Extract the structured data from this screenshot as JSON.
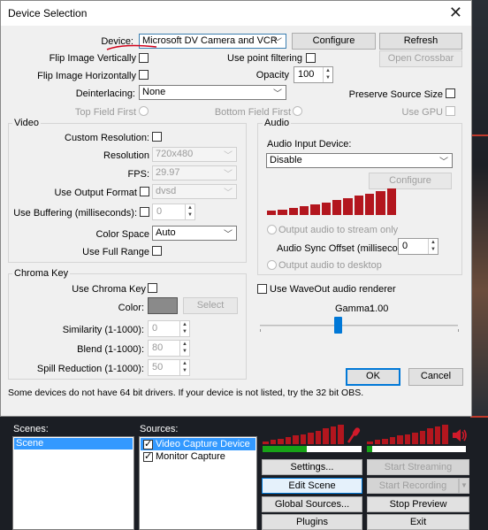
{
  "dialog": {
    "title": "Device Selection",
    "close_glyph": "✕",
    "device": {
      "label": "Device:",
      "value": "Microsoft DV Camera and VCR",
      "configure": "Configure",
      "refresh": "Refresh"
    },
    "flip_v": "Flip Image Vertically",
    "flip_h": "Flip Image Horizontally",
    "point_filtering": "Use point filtering",
    "open_crossbar": "Open Crossbar",
    "opacity": {
      "label": "Opacity",
      "value": "100"
    },
    "deinterlacing": {
      "label": "Deinterlacing:",
      "value": "None"
    },
    "preserve_source_size": "Preserve Source Size",
    "top_field_first": "Top Field First",
    "bottom_field_first": "Bottom Field First",
    "use_gpu": "Use GPU",
    "video": {
      "title": "Video",
      "custom_resolution": "Custom Resolution:",
      "resolution": {
        "label": "Resolution",
        "value": "720x480"
      },
      "fps": {
        "label": "FPS:",
        "value": "29.97"
      },
      "output_format": {
        "label": "Use Output Format",
        "value": "dvsd"
      },
      "buffering": {
        "label": "Use Buffering (milliseconds):",
        "value": "0"
      },
      "color_space": {
        "label": "Color Space",
        "value": "Auto"
      },
      "full_range": "Use Full Range"
    },
    "chroma": {
      "title": "Chroma Key",
      "use_chroma": "Use Chroma Key",
      "color_label": "Color:",
      "color_value": "#8a8a8a",
      "select": "Select",
      "similarity": {
        "label": "Similarity (1-1000):",
        "value": "0"
      },
      "blend": {
        "label": "Blend (1-1000):",
        "value": "80"
      },
      "spill": {
        "label": "Spill Reduction (1-1000):",
        "value": "50"
      }
    },
    "audio": {
      "title": "Audio",
      "input_device_label": "Audio Input Device:",
      "input_device_value": "Disable",
      "configure": "Configure",
      "meter_level": 1.0,
      "output_stream_only": "Output audio to stream only",
      "sync_offset": {
        "label": "Audio Sync Offset (milliseconds):",
        "value": "0"
      },
      "output_desktop": "Output audio to desktop"
    },
    "waveout": "Use WaveOut audio renderer",
    "gamma": {
      "label": "Gamma:",
      "value": "1.00"
    },
    "ok": "OK",
    "cancel": "Cancel",
    "footer_note": "Some devices do not have 64 bit drivers. If your device is not listed, try the 32 bit OBS.",
    "accent_color": "#0078d7",
    "meter_color": "#b3161e"
  },
  "obs": {
    "scenes_label": "Scenes:",
    "sources_label": "Sources:",
    "scenes": [
      "Scene"
    ],
    "sources": [
      {
        "name": "Video Capture Device",
        "checked": true,
        "selected": true
      },
      {
        "name": "Monitor Capture",
        "checked": true,
        "selected": false
      }
    ],
    "buttons": {
      "settings": "Settings...",
      "start_streaming": "Start Streaming",
      "edit_scene": "Edit Scene",
      "start_recording": "Start Recording",
      "global_sources": "Global Sources...",
      "stop_preview": "Stop Preview",
      "plugins": "Plugins",
      "exit": "Exit"
    },
    "mic_icon": "microphone-icon",
    "speaker_icon": "speaker-icon"
  }
}
